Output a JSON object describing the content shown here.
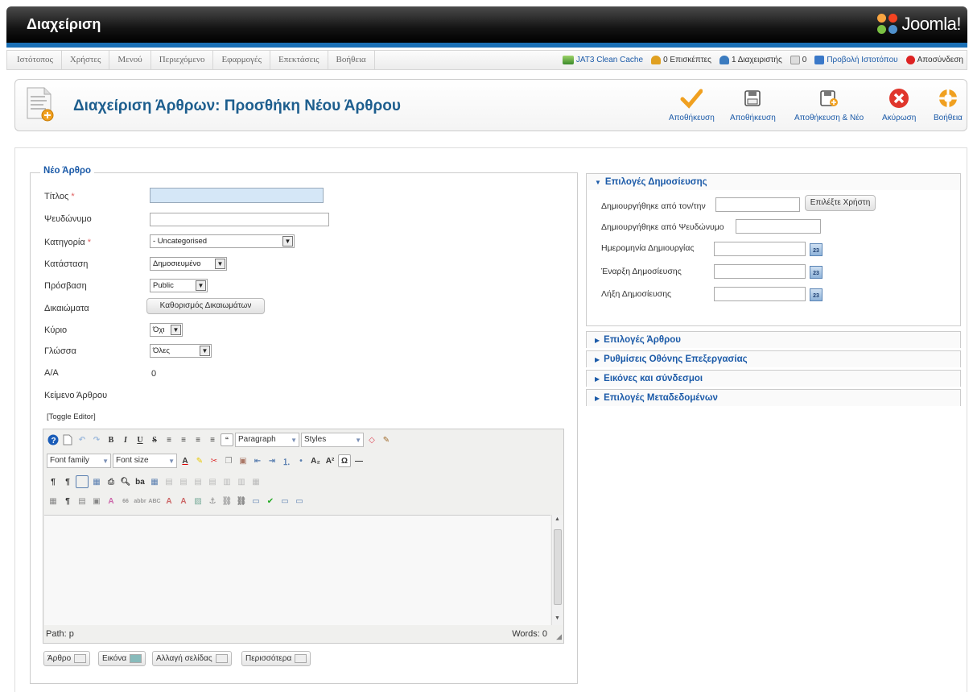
{
  "header": {
    "title": "Διαχείριση",
    "logo_text": "Joomla!"
  },
  "menu": [
    "Ιστότοπος",
    "Χρήστες",
    "Μενού",
    "Περιεχόμενο",
    "Εφαρμογές",
    "Επεκτάσεις",
    "Βοήθεια"
  ],
  "status": {
    "cache": "JAT3 Clean Cache",
    "visitors": "0 Επισκέπτες",
    "admins": "1 Διαχειριστής",
    "messages": "0",
    "view_site": "Προβολή Ιστοτόπου",
    "logout": "Αποσύνδεση"
  },
  "page_title": "Διαχείριση Άρθρων: Προσθήκη Νέου Άρθρου",
  "toolbar": {
    "apply": "Αποθήκευση",
    "save": "Αποθήκευση",
    "save_new": "Αποθήκευση & Νέο",
    "cancel": "Ακύρωση",
    "help": "Βοήθεια"
  },
  "form": {
    "legend": "Νέο Άρθρο",
    "title_label": "Τίτλος",
    "alias_label": "Ψευδώνυμο",
    "category_label": "Κατηγορία",
    "category_value": "- Uncategorised",
    "state_label": "Κατάσταση",
    "state_value": "Δημοσιευμένο",
    "access_label": "Πρόσβαση",
    "access_value": "Public",
    "permissions_label": "Δικαιώματα",
    "permissions_button": "Καθορισμός Δικαιωμάτων",
    "featured_label": "Κύριο",
    "featured_value": "Όχι",
    "language_label": "Γλώσσα",
    "language_value": "Όλες",
    "id_label": "Α/Α",
    "id_value": "0",
    "text_label": "Κείμενο Άρθρου",
    "toggle_editor": "[Toggle Editor]",
    "required_mark": "*"
  },
  "editor": {
    "format_value": "Paragraph",
    "styles_value": "Styles",
    "font_family": "Font family",
    "font_size": "Font size",
    "path": "Path: p",
    "words": "Words: 0"
  },
  "bottom_buttons": [
    "Άρθρο",
    "Εικόνα",
    "Αλλαγή σελίδας",
    "Περισσότερα"
  ],
  "publishing": {
    "header": "Επιλογές Δημοσίευσης",
    "created_by": "Δημιουργήθηκε από τον/την",
    "select_user": "Επιλέξτε Χρήστη",
    "created_by_alias": "Δημιουργήθηκε από Ψευδώνυμο",
    "created_date": "Ημερομηνία Δημιουργίας",
    "publish_up": "Έναρξη Δημοσίευσης",
    "publish_down": "Λήξη Δημοσίευσης",
    "calendar_day": "23"
  },
  "collapsed_panels": [
    "Επιλογές Άρθρου",
    "Ρυθμίσεις Οθόνης Επεξεργασίας",
    "Εικόνες και σύνδεσμοι",
    "Επιλογές Μεταδεδομένων"
  ]
}
